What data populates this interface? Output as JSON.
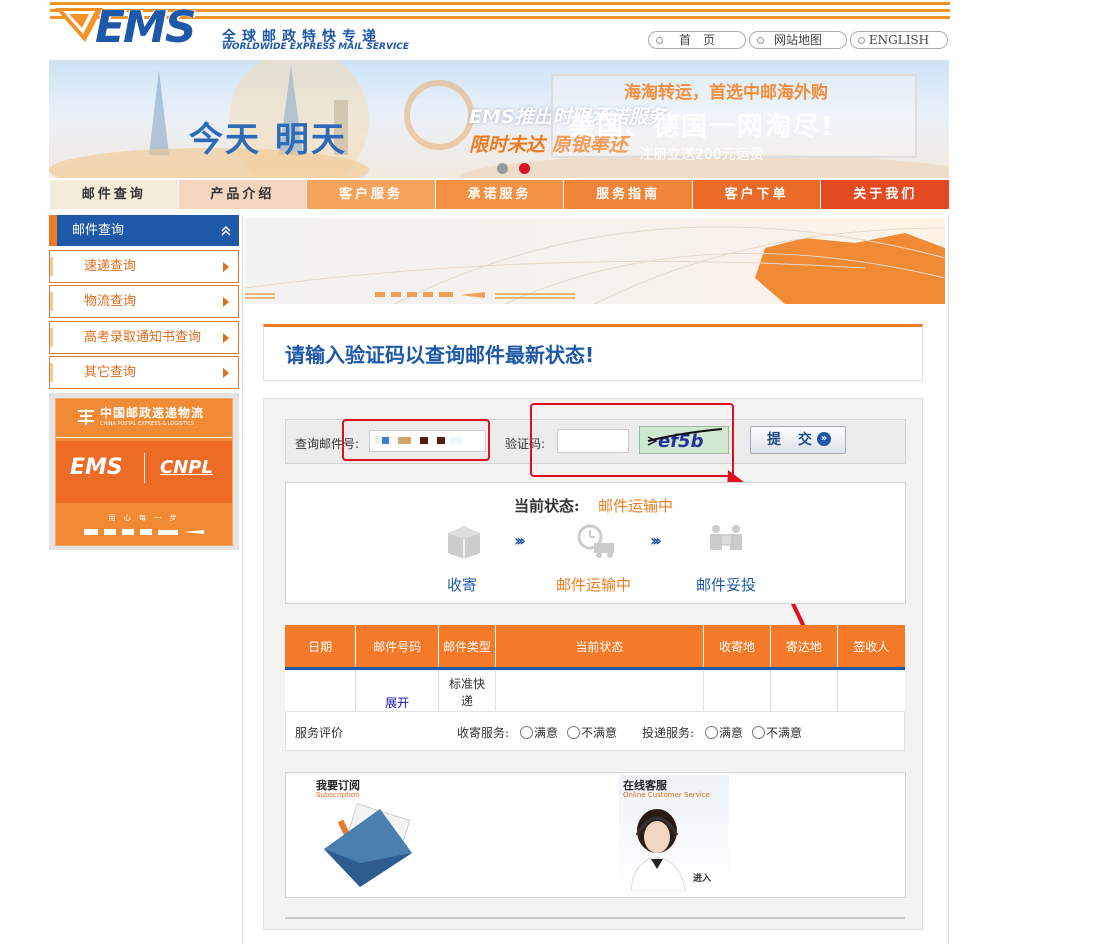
{
  "header": {
    "logo_text": "EMS",
    "logo_cn": "全球邮政特快专递",
    "logo_en": "WORLDWIDE EXPRESS MAIL SERVICE",
    "links": [
      "首　页",
      "网站地图",
      "ENGLISH"
    ]
  },
  "banner": {
    "slogan_main": "今天 明天",
    "ems_line1": "EMS推出时限承诺服务",
    "ems_line2": "限时未达 原银奉还",
    "haitao": "海淘转运，首选中邮海外购",
    "haitao_big": "美国、德国一网淘尽!",
    "register": "注册立送200元运费"
  },
  "nav": {
    "items": [
      "邮件查询",
      "产品介绍",
      "客户服务",
      "承诺服务",
      "服务指南",
      "客户下单",
      "关于我们"
    ],
    "colors": [
      "#f4ecd9",
      "#f4d5bd",
      "#f6a45c",
      "#f39043",
      "#f0853a",
      "#ea6a28",
      "#e44a22"
    ]
  },
  "sidebar": {
    "header": "邮件查询",
    "items": [
      "速递查询",
      "物流查询",
      "高考录取通知书查询",
      "其它查询"
    ],
    "promo": {
      "cn": "中国邮政速递物流",
      "en": "CHINA POSTAL EXPRESS & LOGISTICS",
      "ems": "EMS",
      "cnpl": "CNPL",
      "slogan": "用 心 每 一 步"
    }
  },
  "main": {
    "title": "请输入验证码以查询邮件最新状态!",
    "query": {
      "mail_no_label": "查询邮件号:",
      "captcha_label": "验证码:",
      "captcha_text": "ef5b",
      "submit": "提 交"
    },
    "status": {
      "label": "当前状态:",
      "value": "邮件运输中",
      "steps": [
        "收寄",
        "邮件运输中",
        "邮件妥投"
      ]
    },
    "table": {
      "headers": [
        "日期",
        "邮件号码",
        "邮件类型",
        "当前状态",
        "收寄地",
        "寄达地",
        "签收人"
      ],
      "row": {
        "date": "",
        "mail_no": "展开",
        "type": "标准快递",
        "status": "",
        "origin": "",
        "dest": "",
        "signer": ""
      }
    },
    "rating": {
      "label": "服务评价",
      "collect_label": "收寄服务:",
      "deliver_label": "投递服务:",
      "satisfied": "满意",
      "unsatisfied": "不满意"
    },
    "promos": {
      "subscribe_cn": "我要订阅",
      "subscribe_en": "Subscription",
      "online_cn": "在线客服",
      "online_en": "Online Customer Service",
      "enter": "进入"
    }
  }
}
